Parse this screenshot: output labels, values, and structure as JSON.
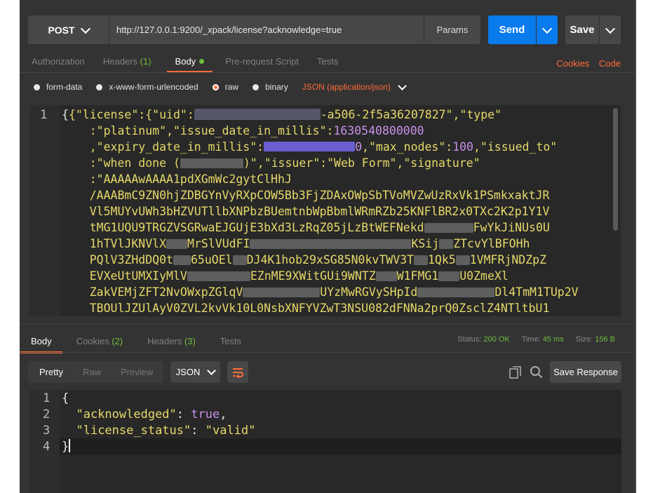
{
  "request": {
    "method": "POST",
    "url": "http://127.0.0.1:9200/_xpack/license?acknowledge=true",
    "params_label": "Params",
    "send_label": "Send",
    "save_label": "Save"
  },
  "request_tabs": [
    {
      "label": "Authorization"
    },
    {
      "label": "Headers",
      "count": "(1)"
    },
    {
      "label": "Body"
    },
    {
      "label": "Pre-request Script"
    },
    {
      "label": "Tests"
    }
  ],
  "request_links": {
    "cookies": "Cookies",
    "code": "Code"
  },
  "body_options": [
    "form-data",
    "x-www-form-urlencoded",
    "raw",
    "binary"
  ],
  "body_type": "JSON (application/json)",
  "request_body": {
    "line_number": "1",
    "lines": [
      [
        "{\"license\":{\"uid\":",
        "-a506-2f5a36207827\",\"type\""
      ],
      [
        ":\"platinum\",\"issue_date_in_millis\":",
        "1630540800000"
      ],
      [
        ",\"expiry_date_in_millis\":",
        "0",
        ",\"max_nodes\":",
        "100",
        ",\"issued_to\""
      ],
      [
        ":\"when done (",
        ")\",\"issuer\":\"Web Form\",\"signature\""
      ],
      [
        ":\"AAAAAwAAAA1pdXGmWc2gytClHhJ"
      ],
      [
        "/AAABmC9ZN0hjZDBGYnVyRXpCOW5Bb3FjZDAxOWpSbTVoMVZwUzRxVk1PSmkxaktJR"
      ],
      [
        "Vl5MUYvUWh3bHZVUTllbXNPbzBUemtnbWpBbmlWRmRZb25KNFlBR2x0TXc2K2p1Y1V"
      ],
      [
        "tMG1UQU9TRGZVSGRwaEJGUjE3bXd3LzRqZ05jLzBtWEFNekd",
        "FwYkJiNUs0U"
      ],
      [
        "1hTVlJKNVlX",
        "MrSlVUdFI",
        "KSij",
        "ZTcvYlBFOHh"
      ],
      [
        "PQlV3ZHdDQ0t",
        "65uOEl",
        "DJ4K1hob29xSG85N0kvTWV3T",
        "1Qk5",
        "1VMFRjNDZpZ"
      ],
      [
        "EVXeUtUMXIyMlV",
        "EZnME9XWitGUi9WNTZ",
        "W1FMG1",
        "U0ZmeXl"
      ],
      [
        "ZakVEMjZFT2NvOWxpZGlqV",
        "UYzMwRGVySHpId",
        "Dl4TmM1TUp2V"
      ],
      [
        "TBOUlJZUlAyV0ZVL2kvVk10L0NsbXNFYVZwT3NSU082dFNNa2prQ0ZsclZ4NTltbU1"
      ]
    ]
  },
  "response_tabs": [
    {
      "label": "Body"
    },
    {
      "label": "Cookies",
      "count": "(2)"
    },
    {
      "label": "Headers",
      "count": "(3)"
    },
    {
      "label": "Tests"
    }
  ],
  "response_status": {
    "status_label": "Status:",
    "status_value": "200 OK",
    "time_label": "Time:",
    "time_value": "45 ms",
    "size_label": "Size:",
    "size_value": "156 B"
  },
  "response_formats": [
    "Pretty",
    "Raw",
    "Preview"
  ],
  "response_type": "JSON",
  "save_response_label": "Save Response",
  "response_body": {
    "line_numbers": [
      "1",
      "2",
      "3",
      "4"
    ],
    "lines": [
      "{",
      "  \"acknowledged\": true,",
      "  \"license_status\": \"valid\"",
      "}"
    ]
  },
  "colors": {
    "accent": "#ff6c37",
    "send": "#097bed",
    "success": "#6cbf3f"
  }
}
